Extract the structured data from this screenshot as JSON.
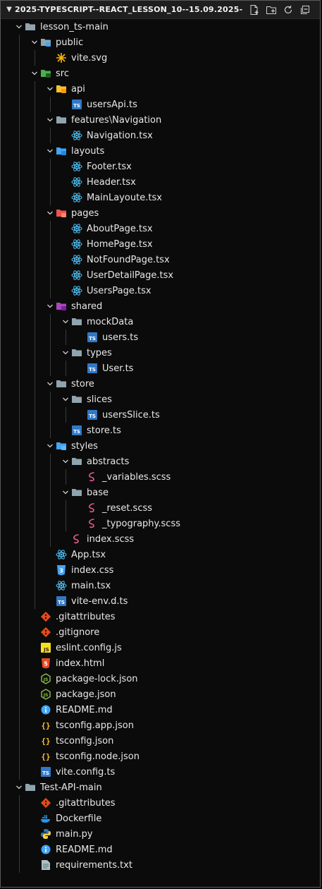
{
  "header": {
    "title": "2025-TYPESCRIPT--REACT_LESSON_10--15.09.2025-"
  },
  "header_actions": [
    "new-file-icon",
    "new-folder-icon",
    "refresh-icon",
    "collapse-all-icon"
  ],
  "tree": [
    {
      "label": "lesson_ts-main",
      "depth": 0,
      "type": "folder",
      "icon": "folder-icon",
      "expanded": true
    },
    {
      "label": "public",
      "depth": 1,
      "type": "folder",
      "icon": "folder-public-icon",
      "expanded": true
    },
    {
      "label": "vite.svg",
      "depth": 2,
      "type": "file",
      "icon": "svg-file-icon"
    },
    {
      "label": "src",
      "depth": 1,
      "type": "folder",
      "icon": "folder-src-icon",
      "expanded": true
    },
    {
      "label": "api",
      "depth": 2,
      "type": "folder",
      "icon": "folder-api-icon",
      "expanded": true
    },
    {
      "label": "usersApi.ts",
      "depth": 3,
      "type": "file",
      "icon": "typescript-icon"
    },
    {
      "label": "features",
      "label_sep": "\\",
      "label_tail": "Navigation",
      "depth": 2,
      "type": "folder",
      "icon": "folder-icon",
      "expanded": true
    },
    {
      "label": "Navigation.tsx",
      "depth": 3,
      "type": "file",
      "icon": "react-icon"
    },
    {
      "label": "layouts",
      "depth": 2,
      "type": "folder",
      "icon": "folder-layout-icon",
      "expanded": true
    },
    {
      "label": "Footer.tsx",
      "depth": 3,
      "type": "file",
      "icon": "react-icon"
    },
    {
      "label": "Header.tsx",
      "depth": 3,
      "type": "file",
      "icon": "react-icon"
    },
    {
      "label": "MainLayoute.tsx",
      "depth": 3,
      "type": "file",
      "icon": "react-icon"
    },
    {
      "label": "pages",
      "depth": 2,
      "type": "folder",
      "icon": "folder-pages-icon",
      "expanded": true
    },
    {
      "label": "AboutPage.tsx",
      "depth": 3,
      "type": "file",
      "icon": "react-icon"
    },
    {
      "label": "HomePage.tsx",
      "depth": 3,
      "type": "file",
      "icon": "react-icon"
    },
    {
      "label": "NotFoundPage.tsx",
      "depth": 3,
      "type": "file",
      "icon": "react-icon"
    },
    {
      "label": "UserDetailPage.tsx",
      "depth": 3,
      "type": "file",
      "icon": "react-icon"
    },
    {
      "label": "UsersPage.tsx",
      "depth": 3,
      "type": "file",
      "icon": "react-icon"
    },
    {
      "label": "shared",
      "depth": 2,
      "type": "folder",
      "icon": "folder-shared-icon",
      "expanded": true
    },
    {
      "label": "mockData",
      "depth": 3,
      "type": "folder",
      "icon": "folder-icon",
      "expanded": true
    },
    {
      "label": "users.ts",
      "depth": 4,
      "type": "file",
      "icon": "typescript-icon"
    },
    {
      "label": "types",
      "depth": 3,
      "type": "folder",
      "icon": "folder-icon",
      "expanded": true
    },
    {
      "label": "User.ts",
      "depth": 4,
      "type": "file",
      "icon": "typescript-icon"
    },
    {
      "label": "store",
      "depth": 2,
      "type": "folder",
      "icon": "folder-icon",
      "expanded": true
    },
    {
      "label": "slices",
      "depth": 3,
      "type": "folder",
      "icon": "folder-icon",
      "expanded": true
    },
    {
      "label": "usersSlice.ts",
      "depth": 4,
      "type": "file",
      "icon": "typescript-icon"
    },
    {
      "label": "store.ts",
      "depth": 3,
      "type": "file",
      "icon": "typescript-icon"
    },
    {
      "label": "styles",
      "depth": 2,
      "type": "folder",
      "icon": "folder-styles-icon",
      "expanded": true
    },
    {
      "label": "abstracts",
      "depth": 3,
      "type": "folder",
      "icon": "folder-icon",
      "expanded": true
    },
    {
      "label": "_variables.scss",
      "depth": 4,
      "type": "file",
      "icon": "sass-icon"
    },
    {
      "label": "base",
      "depth": 3,
      "type": "folder",
      "icon": "folder-icon",
      "expanded": true
    },
    {
      "label": "_reset.scss",
      "depth": 4,
      "type": "file",
      "icon": "sass-icon"
    },
    {
      "label": "_typography.scss",
      "depth": 4,
      "type": "file",
      "icon": "sass-icon"
    },
    {
      "label": "index.scss",
      "depth": 3,
      "type": "file",
      "icon": "sass-icon"
    },
    {
      "label": "App.tsx",
      "depth": 2,
      "type": "file",
      "icon": "react-icon"
    },
    {
      "label": "index.css",
      "depth": 2,
      "type": "file",
      "icon": "css-icon"
    },
    {
      "label": "main.tsx",
      "depth": 2,
      "type": "file",
      "icon": "react-icon"
    },
    {
      "label": "vite-env.d.ts",
      "depth": 2,
      "type": "file",
      "icon": "typescript-icon"
    },
    {
      "label": ".gitattributes",
      "depth": 1,
      "type": "file",
      "icon": "git-icon"
    },
    {
      "label": ".gitignore",
      "depth": 1,
      "type": "file",
      "icon": "git-icon"
    },
    {
      "label": "eslint.config.js",
      "depth": 1,
      "type": "file",
      "icon": "javascript-icon"
    },
    {
      "label": "index.html",
      "depth": 1,
      "type": "file",
      "icon": "html-icon"
    },
    {
      "label": "package-lock.json",
      "depth": 1,
      "type": "file",
      "icon": "node-icon"
    },
    {
      "label": "package.json",
      "depth": 1,
      "type": "file",
      "icon": "node-icon"
    },
    {
      "label": "README.md",
      "depth": 1,
      "type": "file",
      "icon": "info-icon"
    },
    {
      "label": "tsconfig.app.json",
      "depth": 1,
      "type": "file",
      "icon": "json-icon"
    },
    {
      "label": "tsconfig.json",
      "depth": 1,
      "type": "file",
      "icon": "json-icon"
    },
    {
      "label": "tsconfig.node.json",
      "depth": 1,
      "type": "file",
      "icon": "json-icon"
    },
    {
      "label": "vite.config.ts",
      "depth": 1,
      "type": "file",
      "icon": "typescript-icon"
    },
    {
      "label": "Test-API-main",
      "depth": 0,
      "type": "folder",
      "icon": "folder-icon",
      "expanded": true
    },
    {
      "label": ".gitattributes",
      "depth": 1,
      "type": "file",
      "icon": "git-icon"
    },
    {
      "label": "Dockerfile",
      "depth": 1,
      "type": "file",
      "icon": "docker-icon"
    },
    {
      "label": "main.py",
      "depth": 1,
      "type": "file",
      "icon": "python-icon"
    },
    {
      "label": "README.md",
      "depth": 1,
      "type": "file",
      "icon": "info-icon"
    },
    {
      "label": "requirements.txt",
      "depth": 1,
      "type": "file",
      "icon": "text-file-icon"
    }
  ],
  "colors": {
    "background": "#0b0b0b",
    "folder": "#90a4ae",
    "typescript": "#3178c6",
    "react": "#4fc3f7",
    "sass": "#e05c8f",
    "git": "#e64a19",
    "javascript": "#f7df1e",
    "html": "#e44d26",
    "node": "#8bc34a",
    "info": "#42a5f5",
    "json": "#fbc02d",
    "css": "#42a5f5",
    "docker": "#2496ed",
    "python": "#3776ab"
  }
}
